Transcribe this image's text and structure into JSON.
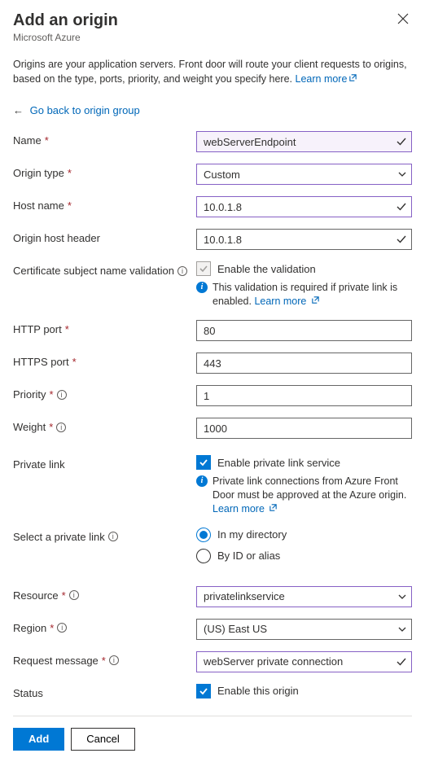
{
  "header": {
    "title": "Add an origin",
    "subtitle": "Microsoft Azure"
  },
  "intro": {
    "text": "Origins are your application servers. Front door will route your client requests to origins, based on the type, ports, priority, and weight you specify here. ",
    "learn_more": "Learn more"
  },
  "backlink": "Go back to origin group",
  "form": {
    "name": {
      "label": "Name",
      "value": "webServerEndpoint"
    },
    "origin_type": {
      "label": "Origin type",
      "value": "Custom"
    },
    "host_name": {
      "label": "Host name",
      "value": "10.0.1.8"
    },
    "origin_host_header": {
      "label": "Origin host header",
      "value": "10.0.1.8"
    },
    "cert_validation": {
      "label": "Certificate subject name validation",
      "checkbox_label": "Enable the validation",
      "note": "This validation is required if private link is enabled. ",
      "note_link": "Learn more"
    },
    "http_port": {
      "label": "HTTP port",
      "value": "80"
    },
    "https_port": {
      "label": "HTTPS port",
      "value": "443"
    },
    "priority": {
      "label": "Priority",
      "value": "1"
    },
    "weight": {
      "label": "Weight",
      "value": "1000"
    },
    "private_link": {
      "label": "Private link",
      "checkbox_label": "Enable private link service",
      "note": "Private link connections from Azure Front Door must be approved at the Azure origin. ",
      "note_link": "Learn more"
    },
    "select_private_link": {
      "label": "Select a private link",
      "option1": "In my directory",
      "option2": "By ID or alias"
    },
    "resource": {
      "label": "Resource",
      "value": "privatelinkservice"
    },
    "region": {
      "label": "Region",
      "value": "(US) East US"
    },
    "request_message": {
      "label": "Request message",
      "value": "webServer private connection"
    },
    "status": {
      "label": "Status",
      "checkbox_label": "Enable this origin"
    }
  },
  "footer": {
    "add": "Add",
    "cancel": "Cancel"
  }
}
